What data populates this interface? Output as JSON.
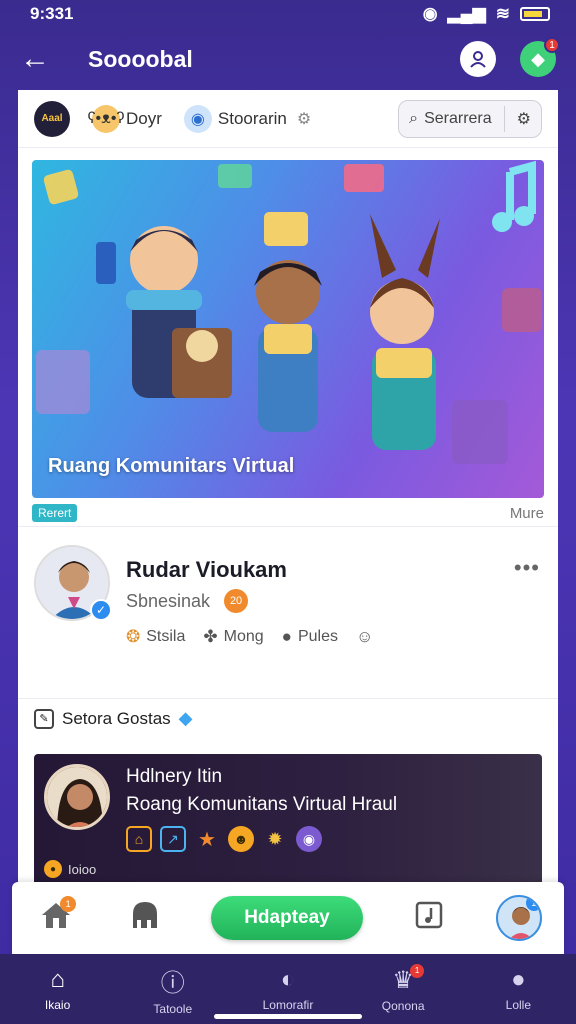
{
  "status_bar": {
    "time": "9:331"
  },
  "app_bar": {
    "title": "Soooobal",
    "notification_count": "1"
  },
  "filter_row": {
    "logo_text": "Aaal",
    "chips": [
      {
        "label": "Doyr",
        "icon": "bear-emoji"
      },
      {
        "label": "Stoorarin",
        "icon": "blue-eye-emoji"
      }
    ],
    "search_placeholder": "Serarrera"
  },
  "hero": {
    "title": "Ruang Komunitars Virtual",
    "tag": "Rerert",
    "more": "Mure"
  },
  "post": {
    "author": "Rudar Vioukam",
    "subtitle": "Sbnesinak",
    "subtitle_emoji": "20",
    "actions": [
      {
        "icon": "medal-icon",
        "label": "Stsila"
      },
      {
        "icon": "puzzle-icon",
        "label": "Mong"
      },
      {
        "icon": "bubble-icon",
        "label": "Pules"
      }
    ]
  },
  "status_line": {
    "text": "Setora Gostas"
  },
  "featured_card": {
    "name": "Hdlnery Itin",
    "description": "Roang Komunitans Virtual Hraul",
    "footer": "Ioioo"
  },
  "action_bar": {
    "primary_label": "Hdapteay",
    "home_badge": "1",
    "profile_badge": "1"
  },
  "bottom_nav": [
    {
      "label": "Ikaio",
      "icon": "home-icon"
    },
    {
      "label": "Tatoole",
      "icon": "alert-icon"
    },
    {
      "label": "Lomorafir",
      "icon": "compass-icon"
    },
    {
      "label": "Qonona",
      "icon": "trophy-icon",
      "badge": "1"
    },
    {
      "label": "Lolle",
      "icon": "person-icon"
    }
  ],
  "colors": {
    "brand_purple": "#3a2b8f",
    "primary_green": "#22b35a",
    "accent_blue": "#2d8cf0"
  }
}
